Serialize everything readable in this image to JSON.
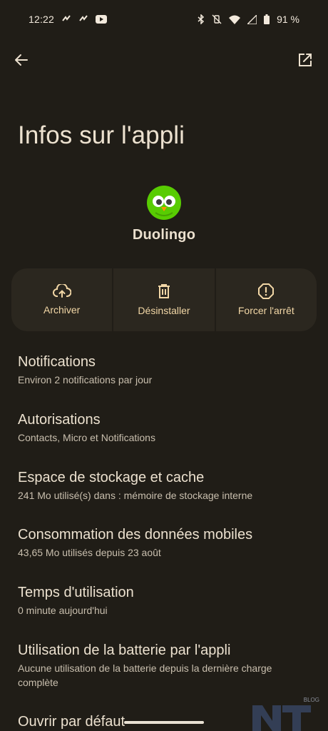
{
  "status_bar": {
    "time": "12:22",
    "battery": "91 %"
  },
  "top_bar": {
    "back_icon": "arrow-back-icon",
    "open_icon": "open-external-icon"
  },
  "page": {
    "title": "Infos sur l'appli"
  },
  "app": {
    "name": "Duolingo",
    "icon": "duolingo-owl-icon"
  },
  "actions": [
    {
      "label": "Archiver",
      "icon": "cloud-upload-icon"
    },
    {
      "label": "Désinstaller",
      "icon": "trash-icon"
    },
    {
      "label": "Forcer l'arrêt",
      "icon": "alert-octagon-icon"
    }
  ],
  "settings": [
    {
      "title": "Notifications",
      "subtitle": "Environ 2 notifications par jour"
    },
    {
      "title": "Autorisations",
      "subtitle": "Contacts, Micro et Notifications"
    },
    {
      "title": "Espace de stockage et cache",
      "subtitle": "241 Mo utilisé(s) dans : mémoire de stockage interne"
    },
    {
      "title": "Consommation des données mobiles",
      "subtitle": "43,65 Mo utilisés depuis 23 août"
    },
    {
      "title": "Temps d'utilisation",
      "subtitle": "0 minute aujourd'hui"
    },
    {
      "title": "Utilisation de la batterie par l'appli",
      "subtitle": "Aucune utilisation de la batterie depuis la dernière charge complète"
    },
    {
      "title": "Ouvrir par défaut",
      "subtitle": ""
    }
  ],
  "watermark": {
    "text": "BLOG"
  },
  "colors": {
    "background": "#201d17",
    "accent": "#f2d7a6",
    "action_bg": "#2b271f"
  }
}
